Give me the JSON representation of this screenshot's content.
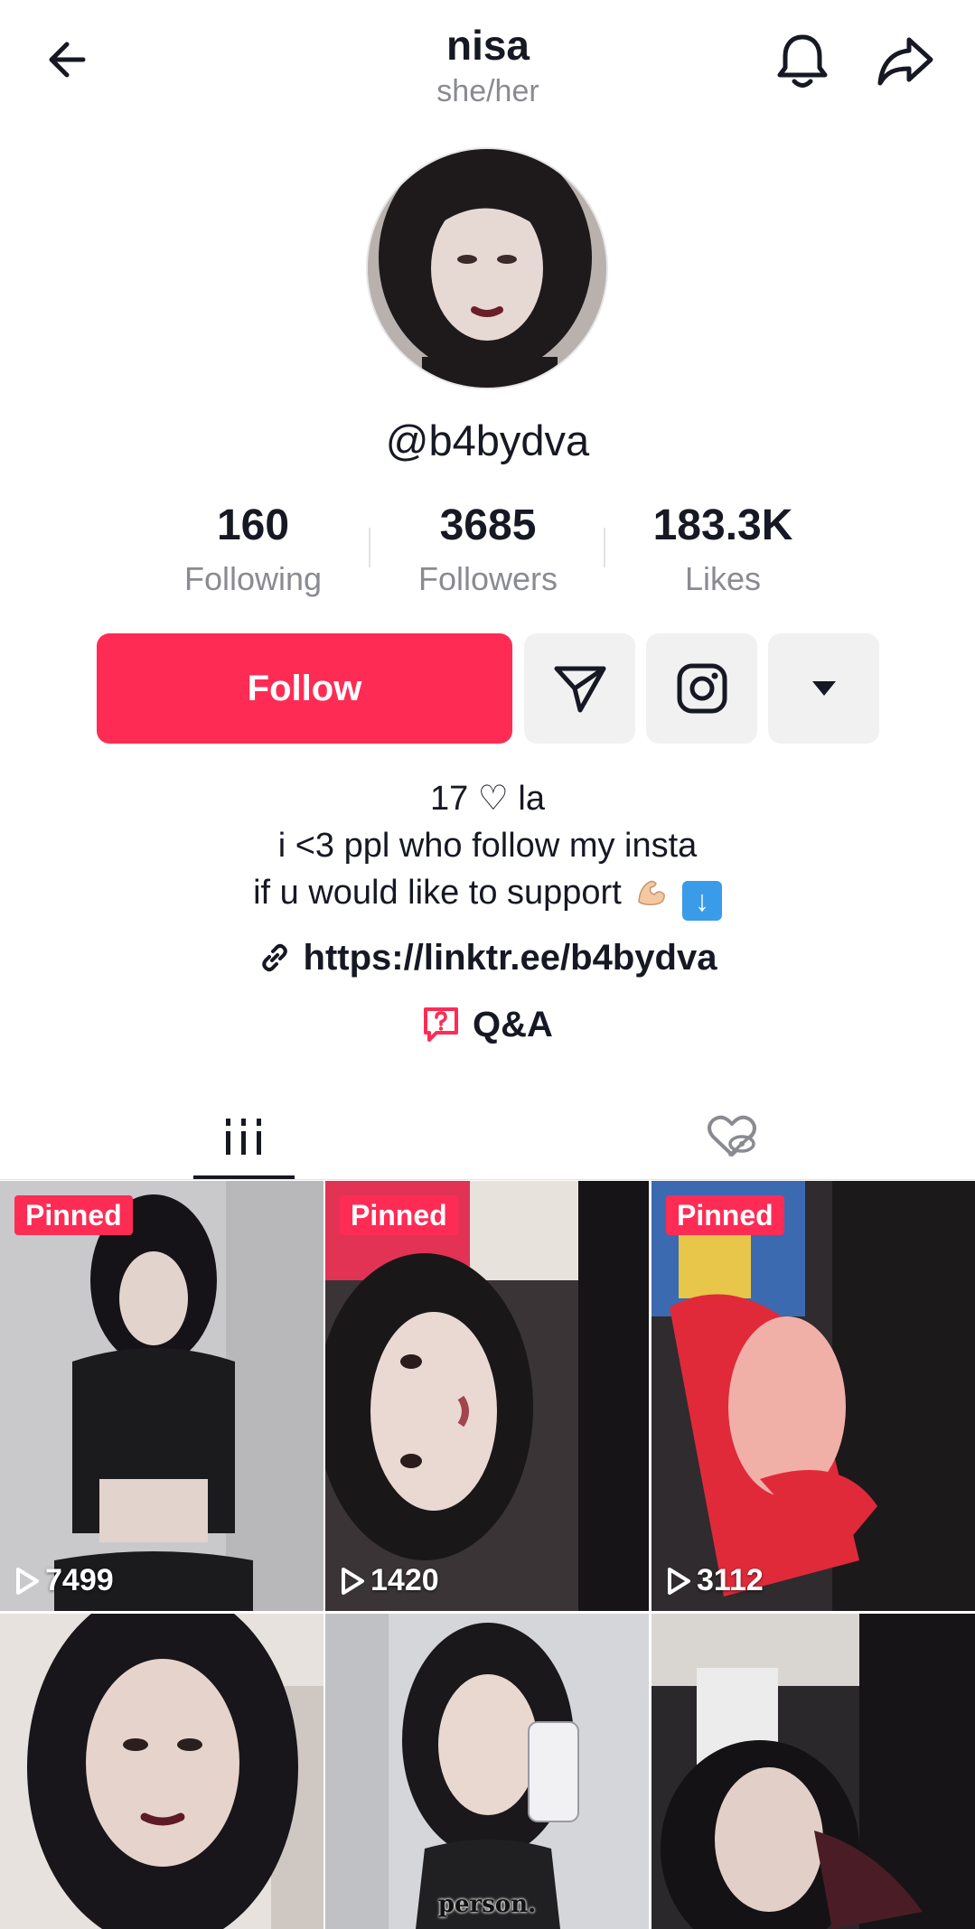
{
  "header": {
    "title": "nisa",
    "pronouns": "she/her",
    "icons": {
      "back": "arrow-left-icon",
      "notifications": "bell-icon",
      "share": "share-icon"
    }
  },
  "profile": {
    "username": "@b4bydva",
    "stats": [
      {
        "value": "160",
        "label": "Following"
      },
      {
        "value": "3685",
        "label": "Followers"
      },
      {
        "value": "183.3K",
        "label": "Likes"
      }
    ]
  },
  "actions": {
    "follow_label": "Follow",
    "icons": [
      "send-message-icon",
      "instagram-icon",
      "caret-down-icon"
    ]
  },
  "bio": {
    "line1": "17 ♡ la",
    "line2": "i <3 ppl who follow my insta",
    "line3": "if u would like to support",
    "emoji": [
      "flexed-biceps-emoji",
      "down-arrow-emoji"
    ],
    "link": "https://linktr.ee/b4bydva",
    "qa_label": "Q&A"
  },
  "tabs": [
    {
      "name": "videos",
      "icon": "grid-icon",
      "active": true
    },
    {
      "name": "liked",
      "icon": "liked-hidden-icon",
      "active": false
    }
  ],
  "videos": [
    {
      "pinned_label": "Pinned",
      "views": "7499"
    },
    {
      "pinned_label": "Pinned",
      "views": "1420"
    },
    {
      "pinned_label": "Pinned",
      "views": "3112"
    },
    {
      "pinned_label": "",
      "views": ""
    },
    {
      "pinned_label": "",
      "views": "",
      "caption": "person."
    },
    {
      "pinned_label": "",
      "views": ""
    }
  ],
  "colors": {
    "accent": "#fe2c55",
    "text_primary": "#161823",
    "text_secondary": "#8a8b91",
    "button_gray": "#f1f1f2"
  }
}
